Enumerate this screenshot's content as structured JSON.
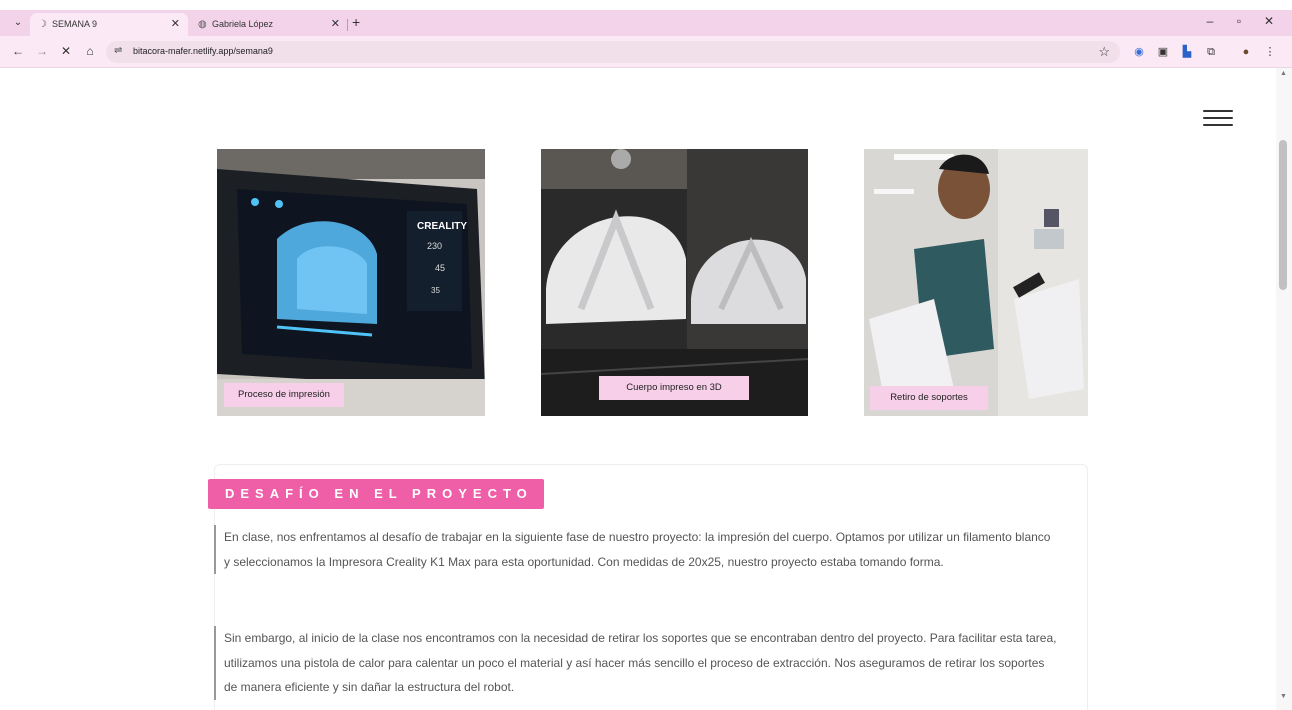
{
  "browser": {
    "tabs": [
      {
        "title": "SEMANA 9",
        "active": true
      },
      {
        "title": "Gabriela López",
        "active": false
      }
    ],
    "url": "bitacora-mafer.netlify.app/semana9",
    "accent": "#f3d3ea"
  },
  "gallery": [
    {
      "caption": "Proceso de impresión"
    },
    {
      "caption": "Cuerpo impreso en 3D"
    },
    {
      "caption": "Retiro de soportes"
    }
  ],
  "screen_text": {
    "brand": "CREALITY",
    "temp1": "230",
    "temp2": "45",
    "temp3": "35"
  },
  "section": {
    "title": "DESAFÍO EN EL PROYECTO",
    "title_color": "#ee5fa8",
    "paragraphs": [
      "En clase, nos enfrentamos al desafío de trabajar en la siguiente fase de nuestro proyecto: la impresión del cuerpo. Optamos por utilizar un filamento blanco y seleccionamos la Impresora Creality K1 Max para esta oportunidad. Con medidas de 20x25, nuestro proyecto estaba tomando forma.",
      "Sin embargo, al inicio de la clase nos encontramos con la necesidad de retirar los soportes que se encontraban dentro del proyecto. Para facilitar esta tarea, utilizamos una pistola de calor para calentar un poco el material y así hacer más sencillo el proceso de extracción. Nos aseguramos de retirar los soportes de manera eficiente y sin dañar la estructura del robot."
    ]
  }
}
